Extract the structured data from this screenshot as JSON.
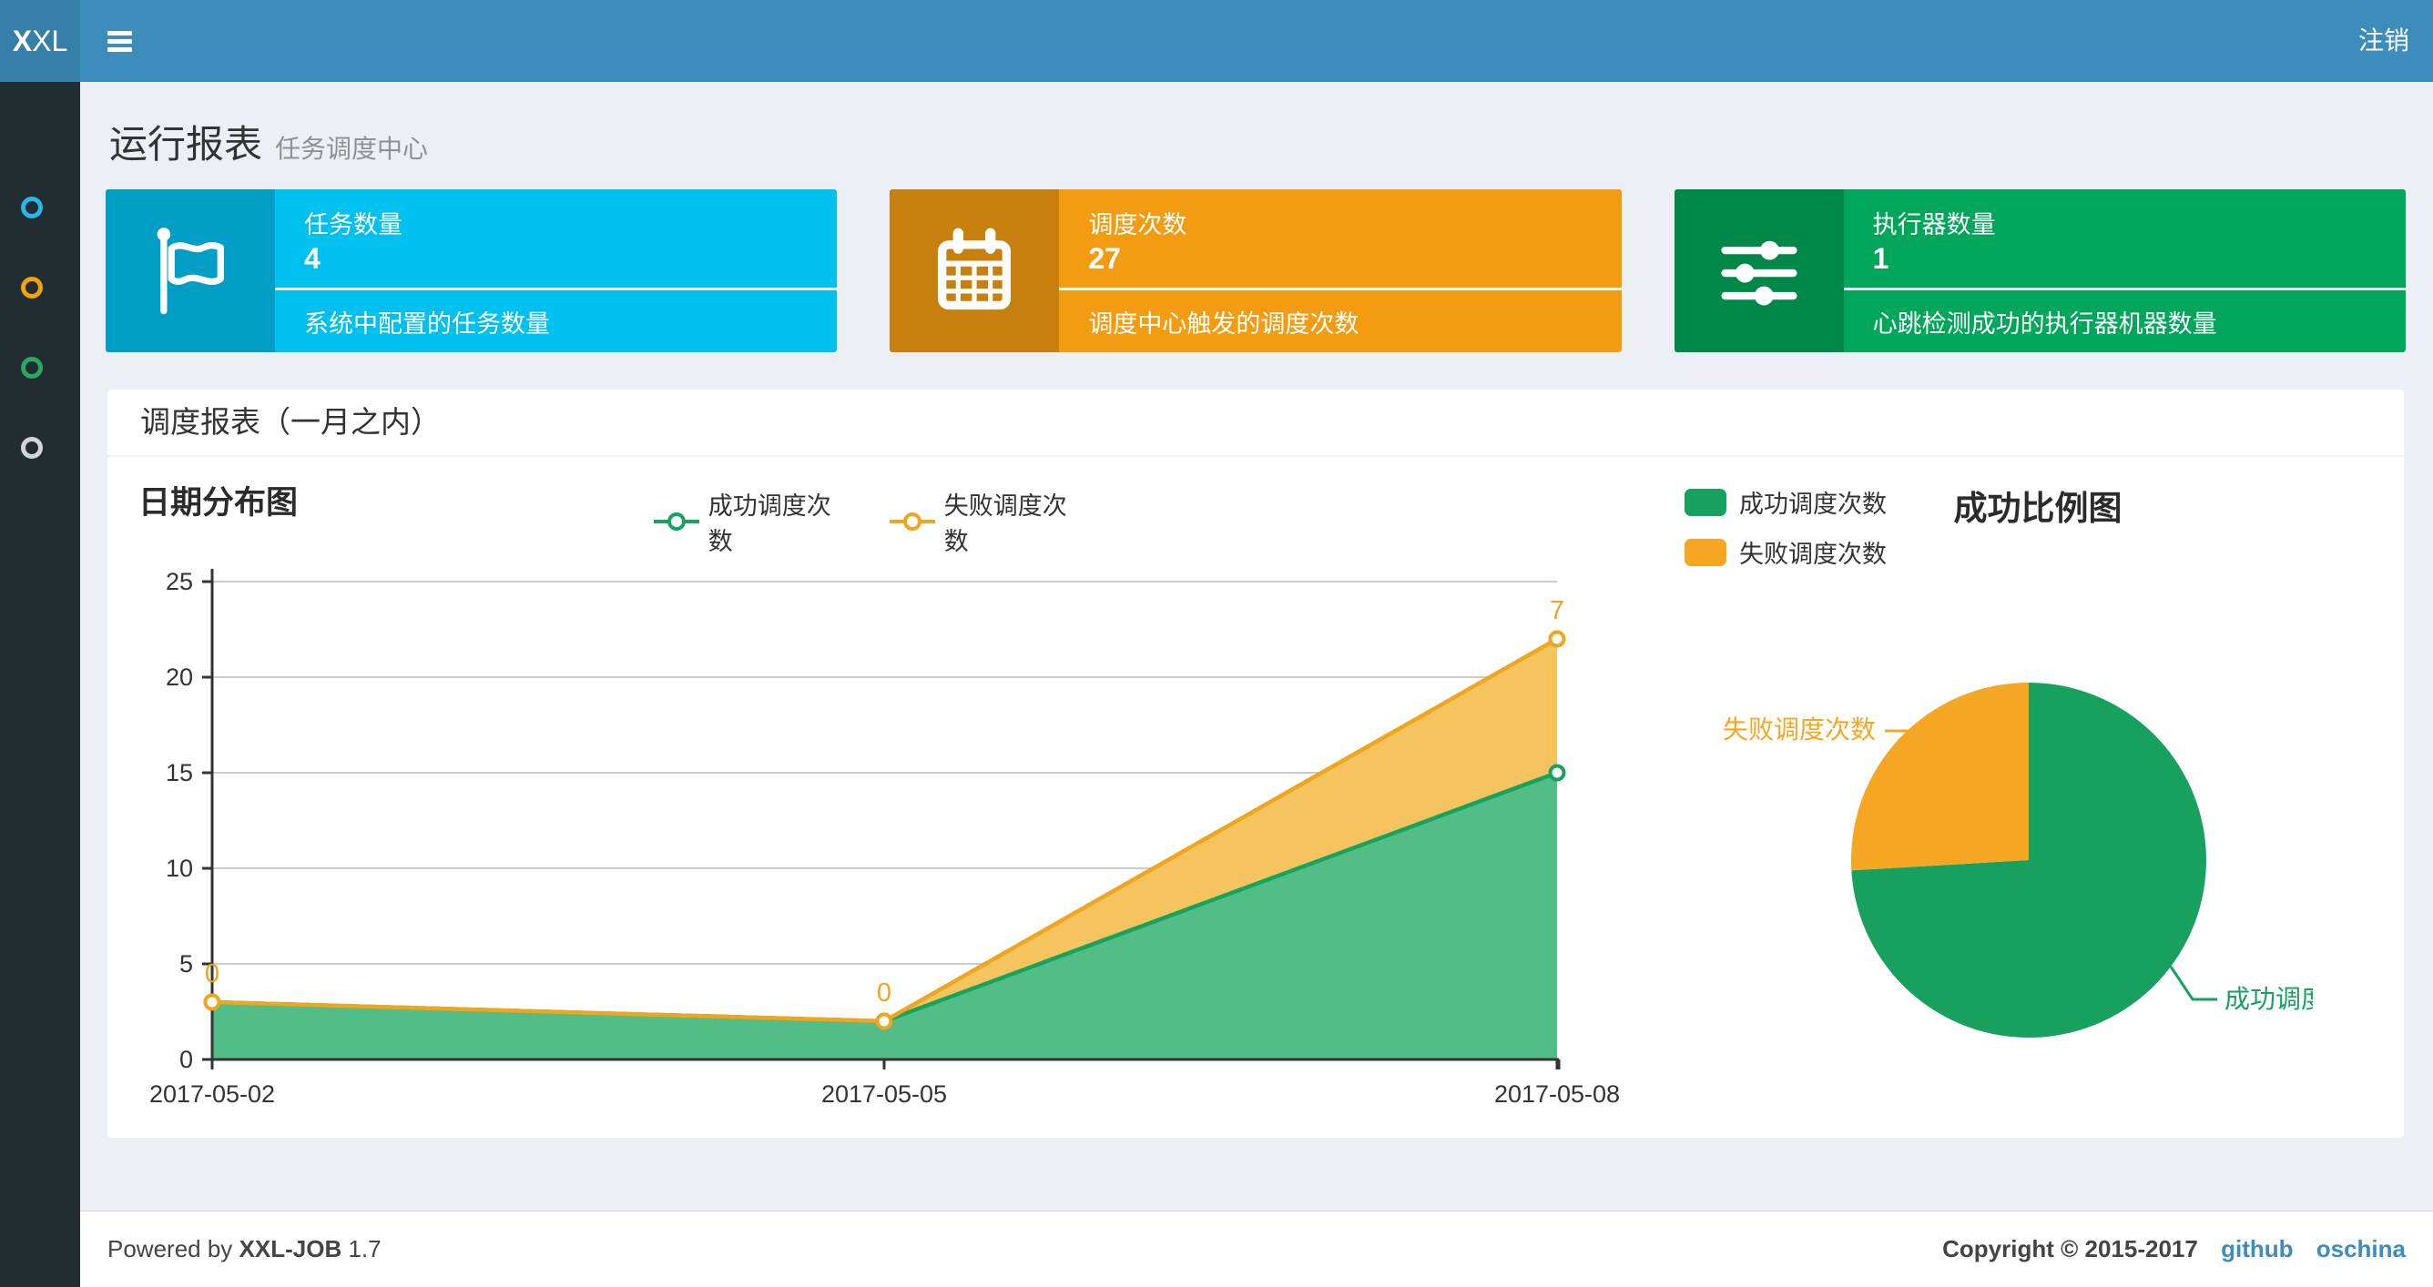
{
  "navbar": {
    "logo_bold": "X",
    "logo_light": "XL",
    "logout_label": "注销"
  },
  "sidebar": {
    "items": [
      {
        "icon": "circle-icon",
        "color": "#29b7e8"
      },
      {
        "icon": "circle-icon",
        "color": "#f0a30a"
      },
      {
        "icon": "circle-icon",
        "color": "#28a860"
      },
      {
        "icon": "circle-icon",
        "color": "#d3d6d8"
      }
    ]
  },
  "page_header": {
    "title": "运行报表",
    "subtitle": "任务调度中心"
  },
  "stat_cards": [
    {
      "title": "任务数量",
      "value": "4",
      "description": "系统中配置的任务数量",
      "color": "#00c0ef",
      "icon": "flag-icon"
    },
    {
      "title": "调度次数",
      "value": "27",
      "description": "调度中心触发的调度次数",
      "color": "#f39c12",
      "icon": "calendar-icon"
    },
    {
      "title": "执行器数量",
      "value": "1",
      "description": "心跳检测成功的执行器机器数量",
      "color": "#00a65a",
      "icon": "sliders-icon"
    }
  ],
  "panel": {
    "title": "调度报表（一月之内）"
  },
  "chart_data": [
    {
      "type": "area",
      "title": "日期分布图",
      "x": [
        "2017-05-02",
        "2017-05-05",
        "2017-05-08"
      ],
      "stacked": true,
      "series": [
        {
          "name": "成功调度次数",
          "values": [
            3,
            2,
            15
          ],
          "color": "#18a35c",
          "fill": "#52bd87"
        },
        {
          "name": "失败调度次数",
          "values": [
            0,
            0,
            7
          ],
          "color": "#f0a51f",
          "fill": "#f6c45f",
          "show_labels": true
        }
      ],
      "ylim": [
        0,
        25
      ],
      "yticks": [
        0,
        5,
        10,
        15,
        20,
        25
      ],
      "grid": true,
      "legend_position": "top-center"
    },
    {
      "type": "pie",
      "title": "成功比例图",
      "legend_position": "top-left",
      "slices": [
        {
          "label": "成功调度次数",
          "value": 20,
          "color": "#17a05e"
        },
        {
          "label": "失败调度次数",
          "value": 7,
          "color": "#f5a623"
        }
      ]
    }
  ],
  "footer": {
    "powered_by": "Powered by",
    "product": "XXL-JOB",
    "version": "1.7",
    "copyright": "Copyright © 2015-2017",
    "links": [
      {
        "label": "github"
      },
      {
        "label": "oschina"
      }
    ],
    "link_color": "#3c8dbc"
  }
}
